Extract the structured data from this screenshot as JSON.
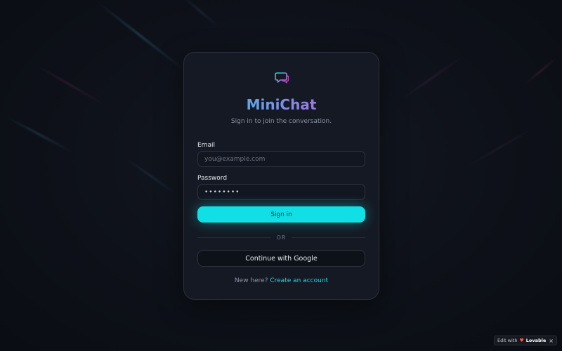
{
  "app": {
    "name": "MiniChat",
    "subtitle": "Sign in to join the conversation."
  },
  "form": {
    "email_label": "Email",
    "email_placeholder": "you@example.com",
    "email_value": "",
    "password_label": "Password",
    "password_value": "••••••••",
    "signin_label": "Sign in",
    "divider_text": "OR",
    "google_label": "Continue with Google"
  },
  "footer": {
    "prompt": "New here?",
    "link": "Create an account"
  },
  "badge": {
    "prefix": "Edit with",
    "brand": "Lovable",
    "close": "×"
  },
  "icons": {
    "logo": "chat-bubbles-icon",
    "badge_logo": "heart-icon"
  },
  "colors": {
    "accent": "#10dfe6",
    "title_gradient_start": "#27d3e0",
    "title_gradient_end": "#d94fd8",
    "card_bg": "#161a24",
    "page_bg": "#0d1017"
  }
}
